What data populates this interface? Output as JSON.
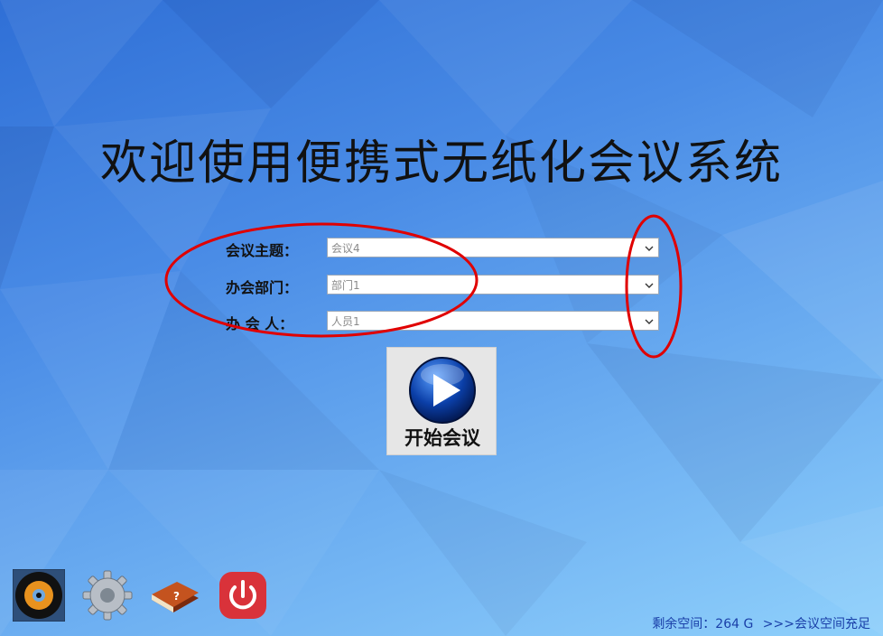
{
  "welcome_title": "欢迎使用便携式无纸化会议系统",
  "form": {
    "topic": {
      "label": "会议主题：",
      "value": "会议4"
    },
    "department": {
      "label": "办会部门：",
      "value": "部门1"
    },
    "host": {
      "label": "办 会 人：",
      "value": "人员1"
    }
  },
  "start_button": {
    "label": "开始会议"
  },
  "status": {
    "space_label": "剩余空间：264 G",
    "space_note": ">>>会议空间充足"
  },
  "colors": {
    "annotation": "#e00000",
    "status_text": "#1a3fa8"
  },
  "toolbar_icons": [
    "disc-icon",
    "gear-icon",
    "book-icon",
    "power-icon"
  ]
}
